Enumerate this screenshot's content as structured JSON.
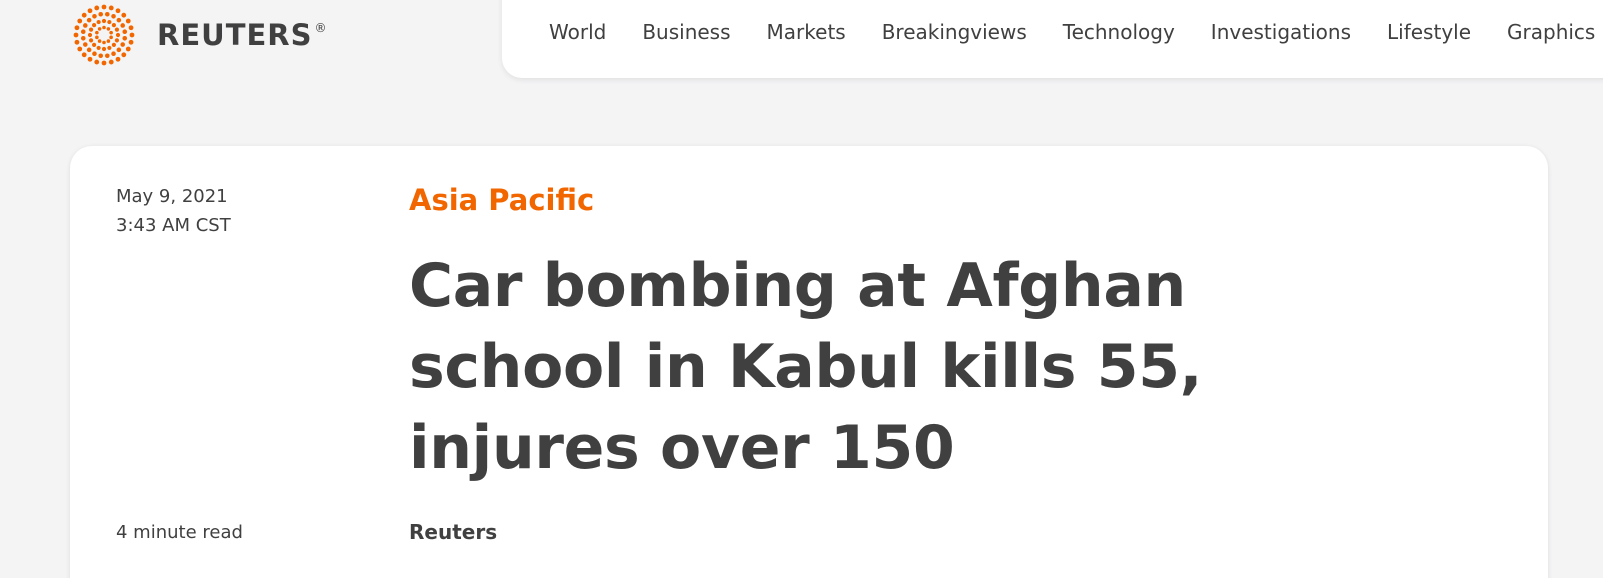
{
  "header": {
    "logo": {
      "text": "REUTERS",
      "registered_mark": "®",
      "icon": "reuters-dot-logo-icon",
      "accent_color": "#f26600"
    },
    "nav": {
      "items": [
        {
          "label": "World"
        },
        {
          "label": "Business"
        },
        {
          "label": "Markets"
        },
        {
          "label": "Breakingviews"
        },
        {
          "label": "Technology"
        },
        {
          "label": "Investigations"
        },
        {
          "label": "Lifestyle"
        },
        {
          "label": "Graphics"
        }
      ]
    }
  },
  "article": {
    "date": "May 9, 2021",
    "time": "3:43 AM CST",
    "section": "Asia Pacific",
    "headline": "Car bombing at Afghan school in Kabul kills 55, injures over 150",
    "read_time": "4 minute read",
    "byline": "Reuters",
    "section_color": "#f26600",
    "text_color": "#404040"
  }
}
